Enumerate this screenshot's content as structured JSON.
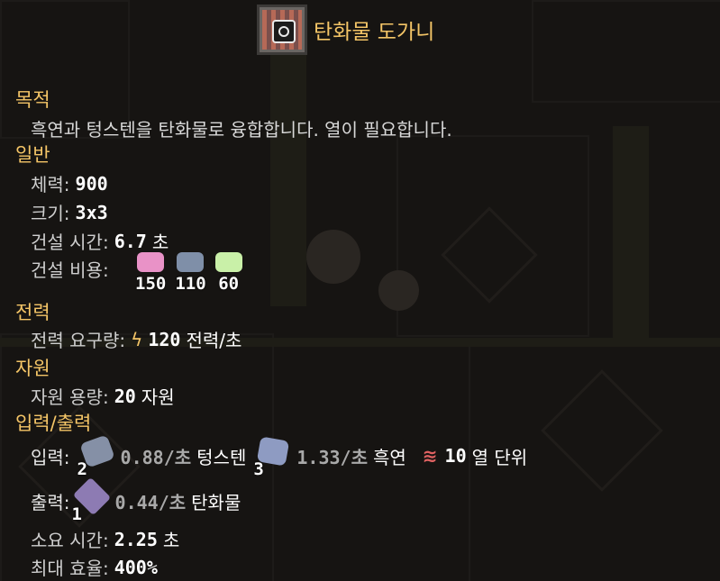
{
  "building": {
    "name": "탄화물 도가니",
    "icon": "carbide-crucible-icon"
  },
  "purpose": {
    "heading": "목적",
    "description": "흑연과 텅스텐을 탄화물로 융합합니다. 열이 필요합니다."
  },
  "general": {
    "heading": "일반",
    "health_label": "체력:",
    "health_value": "900",
    "size_label": "크기:",
    "size_value": "3x3",
    "build_time_label": "건설 시간:",
    "build_time_value": "6.7",
    "build_time_unit": "초",
    "build_cost_label": "건설 비용:",
    "build_cost": [
      {
        "icon": "pink-crystal-icon",
        "amount": "150",
        "color": "#e992c7"
      },
      {
        "icon": "tungsten-icon",
        "amount": "110",
        "color": "#7f8fa8"
      },
      {
        "icon": "green-crystal-icon",
        "amount": "60",
        "color": "#c9f0a8"
      }
    ]
  },
  "power": {
    "heading": "전력",
    "usage_label": "전력 요구량:",
    "icon": "lightning-icon",
    "usage_value": "120",
    "usage_unit": "전력/초"
  },
  "resources": {
    "heading": "자원",
    "capacity_label": "자원 용량:",
    "capacity_value": "20",
    "capacity_unit": "자원"
  },
  "io": {
    "heading": "입력/출력",
    "input_label": "입력:",
    "inputs": [
      {
        "icon": "tungsten-icon",
        "count": "2",
        "rate": "0.88/초",
        "name": "텅스텐",
        "color": "#8590a6"
      },
      {
        "icon": "graphite-icon",
        "count": "3",
        "rate": "1.33/초",
        "name": "흑연",
        "color": "#8e9bc2"
      }
    ],
    "heat_icon": "heat-icon",
    "heat_symbol": "≋",
    "heat_value": "10",
    "heat_unit": "열 단위",
    "output_label": "출력:",
    "output": {
      "icon": "carbide-icon",
      "count": "1",
      "rate": "0.44/초",
      "name": "탄화물",
      "color": "#8d7bb3"
    },
    "craft_time_label": "소요 시간:",
    "craft_time_value": "2.25",
    "craft_time_unit": "초",
    "max_efficiency_label": "최대 효율:",
    "max_efficiency_value": "400%"
  }
}
